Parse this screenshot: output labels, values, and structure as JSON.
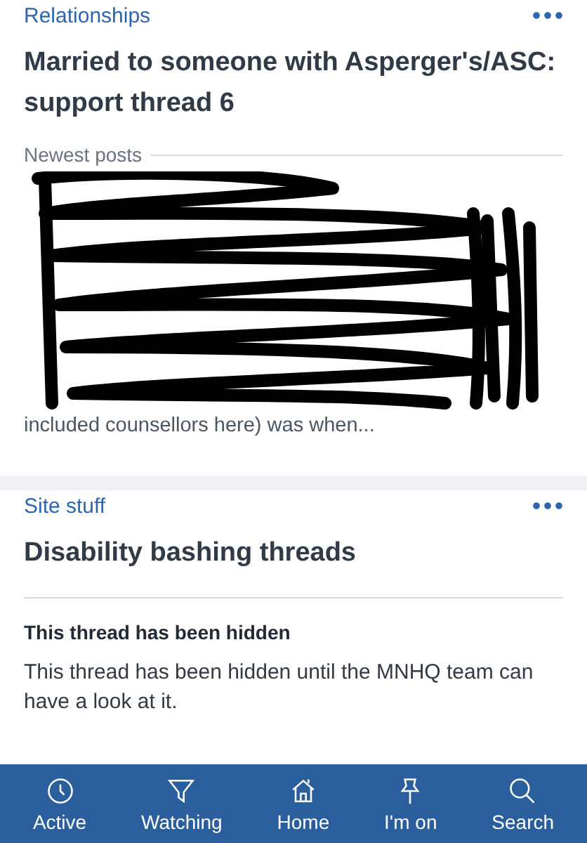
{
  "threads": [
    {
      "category": "Relationships",
      "title": "Married to someone with Asperger's/ASC: support thread 6",
      "kind": "posts",
      "section_label": "Newest posts",
      "visible_text": "included counsellors here) was when..."
    },
    {
      "category": "Site stuff",
      "title": "Disability bashing threads",
      "kind": "hidden",
      "notice_title": "This thread has been hidden",
      "notice_text": "This thread has been hidden until the MNHQ team can have a look at it."
    }
  ],
  "nav": [
    {
      "label": "Active",
      "kind": "clock"
    },
    {
      "label": "Watching",
      "kind": "funnel"
    },
    {
      "label": "Home",
      "kind": "house"
    },
    {
      "label": "I'm on",
      "kind": "pin"
    },
    {
      "label": "Search",
      "kind": "search"
    }
  ]
}
